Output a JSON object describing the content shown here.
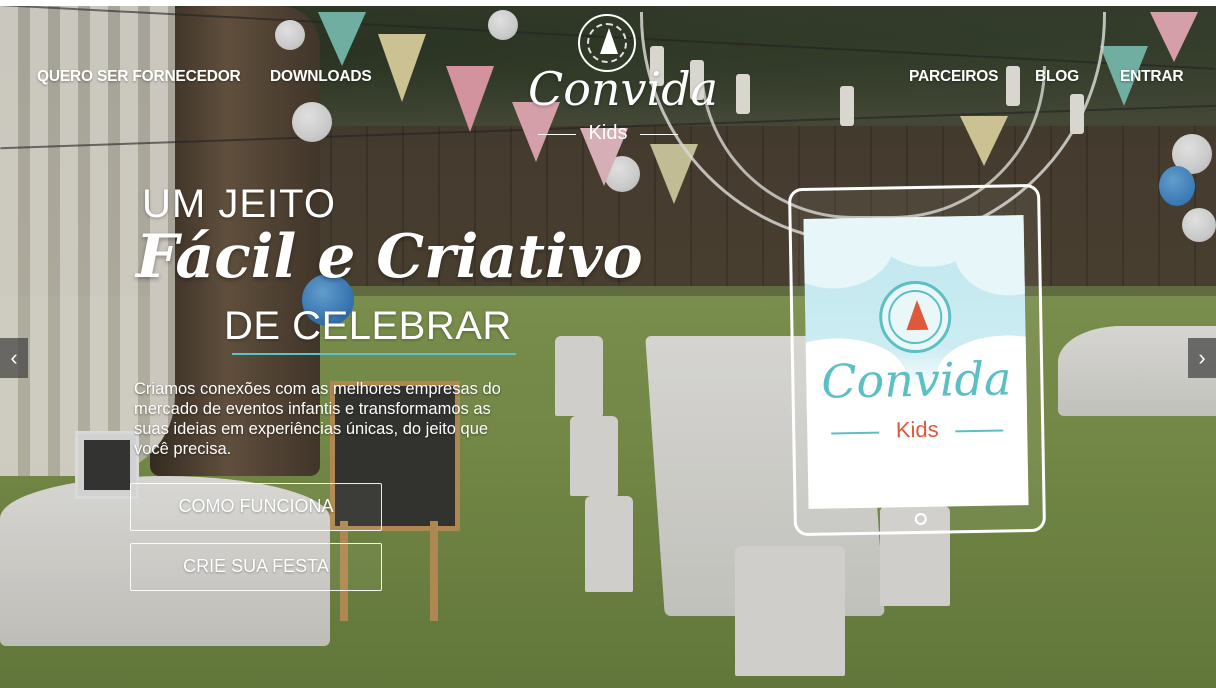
{
  "nav": {
    "left_items": [
      "QUERO SER FORNECEDOR",
      "DOWNLOADS"
    ],
    "right_items": [
      "PARCEIROS",
      "BLOG",
      "ENTRAR"
    ]
  },
  "logo": {
    "name": "Convida",
    "sub": "Kids",
    "hat_icon": "party-hat-icon"
  },
  "hero": {
    "line1": "UM JEITO",
    "line2": "Fácil e Criativo",
    "line3": "DE CELEBRAR",
    "description": "Criamos conexões com as melhores empresas do mercado de eventos infantis e transformamos as suas ideias em experiências únicas, do jeito que você precisa.",
    "buttons": [
      "COMO FUNCIONA",
      "CRIE SUA FESTA"
    ],
    "accent_color": "#5cc3c8"
  },
  "slider": {
    "prev_icon": "chevron-left-icon",
    "next_icon": "chevron-right-icon",
    "prev_glyph": "‹",
    "next_glyph": "›"
  },
  "tablet": {
    "app_name": "Convida",
    "app_sub": "Kids",
    "teal": "#5bbfc4",
    "coral": "#e0583a"
  }
}
